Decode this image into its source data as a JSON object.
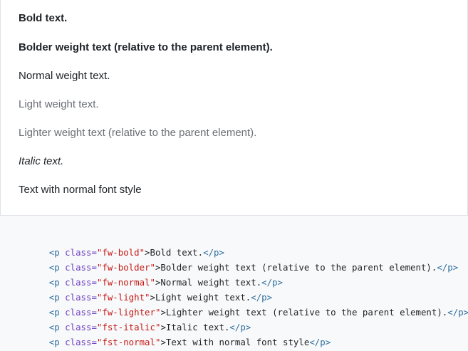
{
  "example": {
    "lines": [
      {
        "text": "Bold text."
      },
      {
        "text": "Bolder weight text (relative to the parent element)."
      },
      {
        "text": "Normal weight text."
      },
      {
        "text": "Light weight text."
      },
      {
        "text": "Lighter weight text (relative to the parent element)."
      },
      {
        "text": "Italic text."
      },
      {
        "text": "Text with normal font style"
      }
    ]
  },
  "code": {
    "lines": [
      {
        "open": "<p",
        "attr": " class=",
        "value": "\"fw-bold\"",
        "content": ">Bold text.",
        "close": "</p>"
      },
      {
        "open": "<p",
        "attr": " class=",
        "value": "\"fw-bolder\"",
        "content": ">Bolder weight text (relative to the parent element).",
        "close": "</p>"
      },
      {
        "open": "<p",
        "attr": " class=",
        "value": "\"fw-normal\"",
        "content": ">Normal weight text.",
        "close": "</p>"
      },
      {
        "open": "<p",
        "attr": " class=",
        "value": "\"fw-light\"",
        "content": ">Light weight text.",
        "close": "</p>"
      },
      {
        "open": "<p",
        "attr": " class=",
        "value": "\"fw-lighter\"",
        "content": ">Lighter weight text (relative to the parent element).",
        "close": "</p>"
      },
      {
        "open": "<p",
        "attr": " class=",
        "value": "\"fst-italic\"",
        "content": ">Italic text.",
        "close": "</p>"
      },
      {
        "open": "<p",
        "attr": " class=",
        "value": "\"fst-normal\"",
        "content": ">Text with normal font style",
        "close": "</p>"
      }
    ]
  },
  "colors": {
    "tag": "#2f6f9f",
    "attribute": "#6f42c1",
    "string": "#c41a16",
    "text": "#212529",
    "light_text": "#6b6f74",
    "code_background": "#f8f9fa",
    "border": "#dee2e6"
  }
}
